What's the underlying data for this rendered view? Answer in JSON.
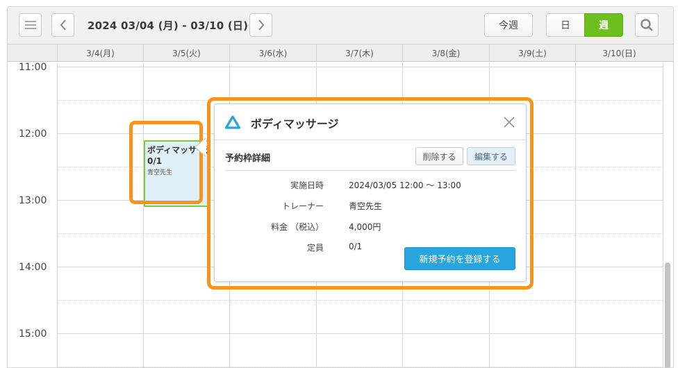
{
  "toolbar": {
    "date_range": "2024 03/04 (月) - 03/10 (日)",
    "today_label": "今週",
    "day_label": "日",
    "week_label": "週"
  },
  "days": [
    "3/4(月)",
    "3/5(火)",
    "3/6(水)",
    "3/7(木)",
    "3/8(金)",
    "3/9(土)",
    "3/10(日)"
  ],
  "times": [
    "11:00",
    "12:00",
    "13:00",
    "14:00",
    "15:00"
  ],
  "event": {
    "title": "ボディマッサージ",
    "count": "0/1",
    "trainer": "青空先生"
  },
  "popup": {
    "title": "ボディマッサージ",
    "section_title": "予約枠詳細",
    "delete_label": "削除する",
    "edit_label": "編集する",
    "details": [
      {
        "label": "実施日時",
        "value": "2024/03/05 12:00 〜 13:00"
      },
      {
        "label": "トレーナー",
        "value": "青空先生"
      },
      {
        "label": "料金 （税込）",
        "value": "4,000円"
      },
      {
        "label": "定員",
        "value": "0/1"
      }
    ],
    "register_label": "新規予約を登録する"
  },
  "colors": {
    "accent_green": "#6cbf1f",
    "highlight_orange": "#f7941d",
    "button_blue": "#27a5dc",
    "event_bg": "#dff0f8"
  }
}
